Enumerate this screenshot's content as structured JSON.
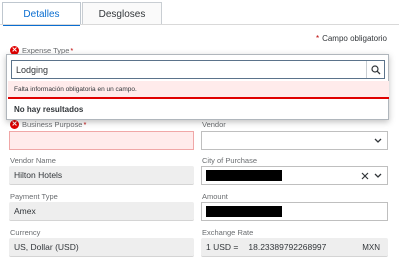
{
  "tabs": [
    {
      "label": "Detalles",
      "active": true
    },
    {
      "label": "Desgloses",
      "active": false
    }
  ],
  "required_note": {
    "star": "*",
    "text": "Campo obligatorio"
  },
  "expense_type": {
    "label": "Expense Type",
    "star": "*",
    "value": "Lodging",
    "error_message": "Falta información obligatoria en un campo.",
    "no_results": "No hay resultados",
    "icon": "search-icon"
  },
  "business_purpose": {
    "label": "Business Purpose",
    "star": "*",
    "value": ""
  },
  "vendor": {
    "label": "Vendor",
    "value": ""
  },
  "vendor_name": {
    "label": "Vendor Name",
    "value": "Hilton Hotels"
  },
  "city_of_purchase": {
    "label": "City of Purchase",
    "value": "[redacted]"
  },
  "payment_type": {
    "label": "Payment Type",
    "value": "Amex"
  },
  "amount": {
    "label": "Amount",
    "value": "[redacted]"
  },
  "currency": {
    "label": "Currency",
    "value": "US, Dollar (USD)"
  },
  "exchange_rate": {
    "label": "Exchange Rate",
    "prefix": "1 USD =",
    "value": "18.23389792268997",
    "unit": "MXN"
  },
  "colors": {
    "accent": "#0a6ed1",
    "error": "#e00000",
    "error_bg": "#ffebeb"
  }
}
